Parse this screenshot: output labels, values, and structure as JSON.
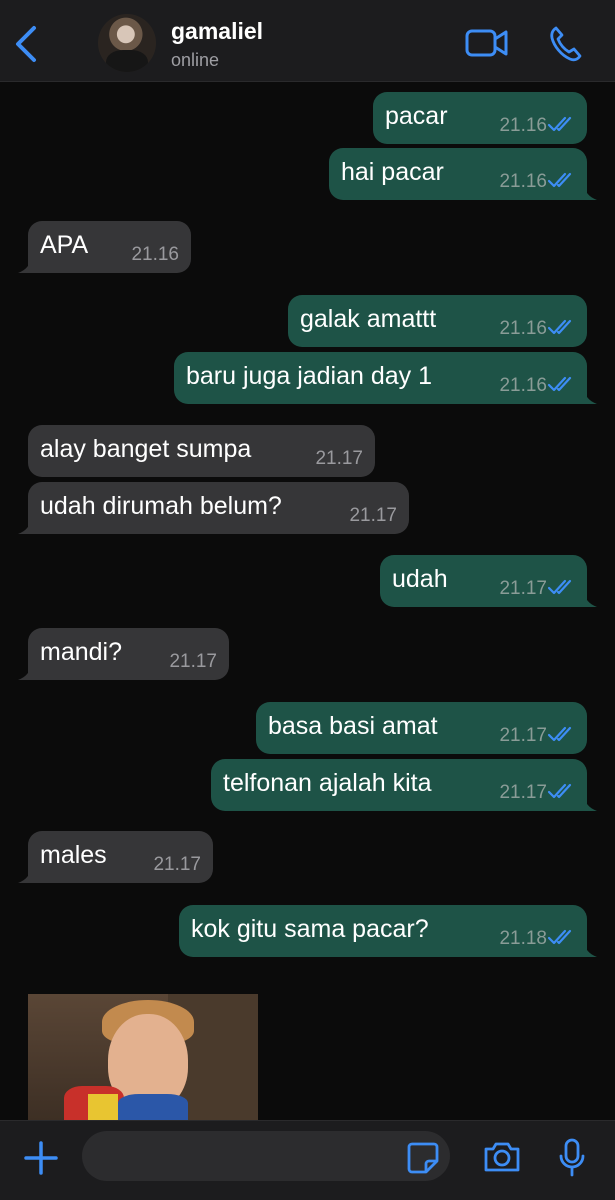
{
  "header": {
    "contact_name": "gamaliel",
    "contact_status": "online"
  },
  "colors": {
    "accent": "#3d8df5",
    "outgoing_bubble": "#1e5347",
    "incoming_bubble": "#363638",
    "background": "#0b0b0b"
  },
  "messages": [
    {
      "direction": "outgoing",
      "text": "pacar",
      "time": "21.16",
      "status": "read"
    },
    {
      "direction": "outgoing",
      "text": "hai pacar",
      "time": "21.16",
      "status": "read"
    },
    {
      "direction": "incoming",
      "text": "APA",
      "time": "21.16"
    },
    {
      "direction": "outgoing",
      "text": "galak amattt",
      "time": "21.16",
      "status": "read"
    },
    {
      "direction": "outgoing",
      "text": "baru juga jadian day 1",
      "time": "21.16",
      "status": "read"
    },
    {
      "direction": "incoming",
      "text": "alay banget sumpa",
      "time": "21.17"
    },
    {
      "direction": "incoming",
      "text": "udah dirumah belum?",
      "time": "21.17"
    },
    {
      "direction": "outgoing",
      "text": "udah",
      "time": "21.17",
      "status": "read"
    },
    {
      "direction": "incoming",
      "text": "mandi?",
      "time": "21.17"
    },
    {
      "direction": "outgoing",
      "text": "basa basi amat",
      "time": "21.17",
      "status": "read"
    },
    {
      "direction": "outgoing",
      "text": "telfonan ajalah kita",
      "time": "21.17",
      "status": "read"
    },
    {
      "direction": "incoming",
      "text": "males",
      "time": "21.17"
    },
    {
      "direction": "outgoing",
      "text": "kok gitu sama pacar?",
      "time": "21.18",
      "status": "read"
    },
    {
      "direction": "incoming",
      "type": "photo"
    }
  ],
  "composer": {
    "placeholder": ""
  },
  "icons": {
    "back": "chevron-left-icon",
    "video": "video-camera-icon",
    "call": "phone-icon",
    "read": "double-check-icon",
    "plus": "plus-icon",
    "sticker": "sticker-icon",
    "camera": "camera-icon",
    "mic": "microphone-icon"
  }
}
